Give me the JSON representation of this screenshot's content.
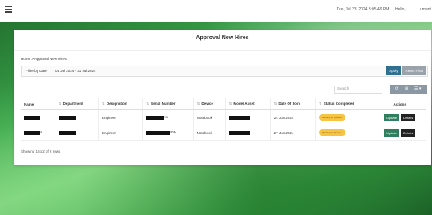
{
  "header": {
    "datetime": "Tue, Jul 23, 2024 3:05:49 PM",
    "greeting": "Hello,",
    "user": "ument"
  },
  "page": {
    "title": "Approval New Hires",
    "breadcrumb": {
      "home": "Home",
      "sep": ">",
      "current": "Approval New Hires"
    }
  },
  "filter": {
    "label": "Filter by Date",
    "range": "01 Jul 2024 - 31 Jul 2024",
    "apply": "Apply",
    "reset": "Reset Filter"
  },
  "search": {
    "placeholder": "Search"
  },
  "tools": {
    "refresh": "⟳",
    "grid": "⊞",
    "menu": "☰ ▾"
  },
  "table": {
    "headers": [
      "Name",
      "Department",
      "Designation",
      "Serial Number",
      "Device",
      "Model Asset",
      "Date Of Join",
      "Status Completed",
      "Actions"
    ],
    "rows": [
      {
        "name_tail": "",
        "designation": "Engineer",
        "serial_tail": "HJ",
        "device": "Notebook",
        "date": "24 Jun 2024",
        "status": "Waiting for Review",
        "update": "Update",
        "details": "Details"
      },
      {
        "name_tail": "a",
        "designation": "Engineer",
        "serial_tail": "RW",
        "device": "Notebook",
        "date": "27 Jun 2024",
        "status": "Waiting for Review",
        "update": "Update",
        "details": "Details"
      }
    ]
  },
  "footer": {
    "showing": "Showing 1 to 2 of 2 rows"
  },
  "colors": {
    "accent": "#2f6f8f",
    "badge": "#f6c343",
    "update": "#2f7f5f"
  }
}
